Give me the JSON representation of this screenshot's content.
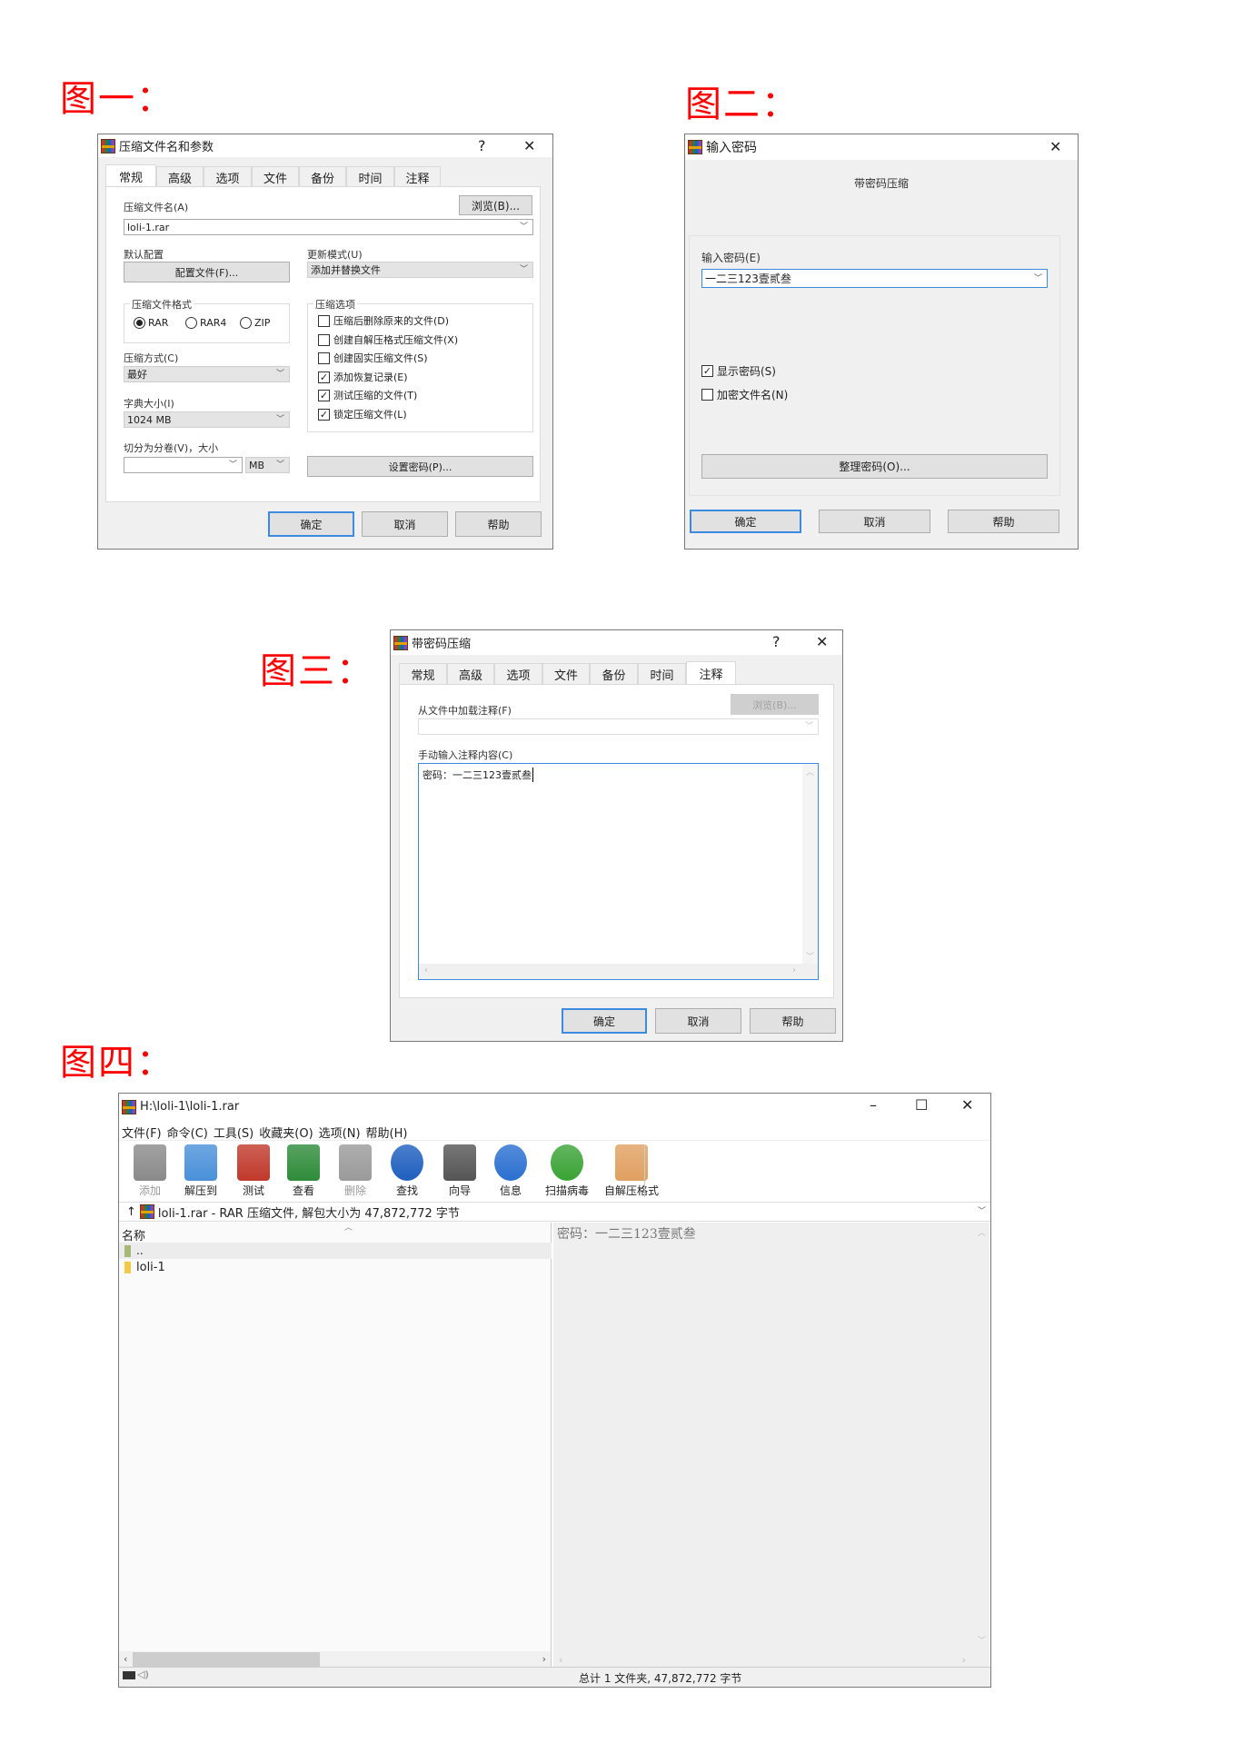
{
  "labels": {
    "fig1": "图一：",
    "fig2": "图二：",
    "fig3": "图三：",
    "fig4": "图四："
  },
  "fig1": {
    "title": "压缩文件名和参数",
    "help": "?",
    "close": "✕",
    "tabs": [
      "常规",
      "高级",
      "选项",
      "文件",
      "备份",
      "时间",
      "注释"
    ],
    "active_tab": "常规",
    "archive_name_label": "压缩文件名(A)",
    "browse": "浏览(B)...",
    "archive_name": "loli-1.rar",
    "profile_label": "默认配置",
    "profile_button": "配置文件(F)...",
    "update_label": "更新模式(U)",
    "update_value": "添加并替换文件",
    "format_label": "压缩文件格式",
    "formats": [
      "RAR",
      "RAR4",
      "ZIP"
    ],
    "format_selected": "RAR",
    "method_label": "压缩方式(C)",
    "method_value": "最好",
    "dict_label": "字典大小(I)",
    "dict_value": "1024 MB",
    "split_label": "切分为分卷(V)，大小",
    "split_value": "",
    "split_unit": "MB",
    "password_button": "设置密码(P)...",
    "options_label": "压缩选项",
    "options": [
      {
        "label": "压缩后删除原来的文件(D)",
        "checked": false
      },
      {
        "label": "创建自解压格式压缩文件(X)",
        "checked": false
      },
      {
        "label": "创建固实压缩文件(S)",
        "checked": false
      },
      {
        "label": "添加恢复记录(E)",
        "checked": true
      },
      {
        "label": "测试压缩的文件(T)",
        "checked": true
      },
      {
        "label": "锁定压缩文件(L)",
        "checked": true
      }
    ],
    "ok": "确定",
    "cancel": "取消",
    "helpbtn": "帮助"
  },
  "fig2": {
    "title": "输入密码",
    "close": "✕",
    "header": "带密码压缩",
    "password_label": "输入密码(E)",
    "password_value": "一二三123壹贰叁",
    "show_password": {
      "label": "显示密码(S)",
      "checked": true
    },
    "encrypt_names": {
      "label": "加密文件名(N)",
      "checked": false
    },
    "organize": "整理密码(O)...",
    "ok": "确定",
    "cancel": "取消",
    "helpbtn": "帮助"
  },
  "fig3": {
    "title": "带密码压缩",
    "help": "?",
    "close": "✕",
    "tabs": [
      "常规",
      "高级",
      "选项",
      "文件",
      "备份",
      "时间",
      "注释"
    ],
    "active_tab": "注释",
    "load_label": "从文件中加载注释(F)",
    "browse": "浏览(B)...",
    "load_value": "",
    "manual_label": "手动输入注释内容(C)",
    "comment": "密码：一二三123壹贰叁",
    "ok": "确定",
    "cancel": "取消",
    "helpbtn": "帮助"
  },
  "fig4": {
    "title": "H:\\loli-1\\loli-1.rar",
    "minimize": "–",
    "maximize": "☐",
    "close": "✕",
    "menu": [
      "文件(F)",
      "命令(C)",
      "工具(S)",
      "收藏夹(O)",
      "选项(N)",
      "帮助(H)"
    ],
    "toolbar": [
      {
        "label": "添加",
        "icon": "add-icon",
        "disabled": true,
        "color": "#8a8a8a"
      },
      {
        "label": "解压到",
        "icon": "extract-folder-icon",
        "disabled": false,
        "color": "#4a90d9"
      },
      {
        "label": "测试",
        "icon": "test-clipboard-icon",
        "disabled": false,
        "color": "#c0392b"
      },
      {
        "label": "查看",
        "icon": "view-book-icon",
        "disabled": false,
        "color": "#2e8b3a"
      },
      {
        "label": "删除",
        "icon": "trash-icon",
        "disabled": true,
        "color": "#9a9a9a"
      },
      {
        "label": "查找",
        "icon": "magnifier-icon",
        "disabled": false,
        "color": "#1f5fbf"
      },
      {
        "label": "向导",
        "icon": "wizard-wand-icon",
        "disabled": false,
        "color": "#555555"
      },
      {
        "label": "信息",
        "icon": "info-icon",
        "disabled": false,
        "color": "#2a6fd0"
      },
      {
        "label": "扫描病毒",
        "icon": "virus-scan-icon",
        "disabled": false,
        "color": "#3aa335"
      },
      {
        "label": "自解压格式",
        "icon": "sfx-box-icon",
        "disabled": false,
        "color": "#e0a060"
      }
    ],
    "address": "loli-1.rar - RAR 压缩文件, 解包大小为 47,872,772 字节",
    "column_name": "名称",
    "files": [
      {
        "name": "..",
        "type": "parent"
      },
      {
        "name": "loli-1",
        "type": "folder"
      }
    ],
    "comment": "密码：一二三123壹贰叁",
    "status": "总计 1 文件夹, 47,872,772 字节"
  }
}
